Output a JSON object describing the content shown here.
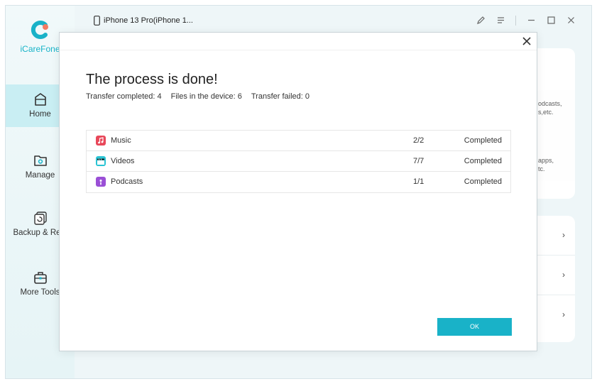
{
  "app": {
    "name": "iCareFone"
  },
  "header": {
    "device_label": "iPhone 13 Pro(iPhone 1..."
  },
  "sidebar": {
    "items": [
      {
        "label": "Home",
        "active": true,
        "icon": "home-icon"
      },
      {
        "label": "Manage",
        "active": false,
        "icon": "folder-gear-icon"
      },
      {
        "label": "Backup & Rest",
        "active": false,
        "icon": "backup-icon"
      },
      {
        "label": "More Tools",
        "active": false,
        "icon": "toolbox-icon"
      }
    ]
  },
  "background": {
    "card_text_1a": "odcasts,",
    "card_text_1b": "s,etc.",
    "card_text_2a": "apps,",
    "card_text_2b": "tc."
  },
  "dialog": {
    "title": "The process is done!",
    "stats": [
      "Transfer completed: 4",
      "Files in the device: 6",
      "Transfer failed: 0"
    ],
    "rows": [
      {
        "name": "Music",
        "count": "2/2",
        "status": "Completed",
        "icon": "music-icon",
        "color": "#e8485a"
      },
      {
        "name": "Videos",
        "count": "7/7",
        "status": "Completed",
        "icon": "clapperboard-icon",
        "color": "#29c4d4"
      },
      {
        "name": "Podcasts",
        "count": "1/1",
        "status": "Completed",
        "icon": "podcast-icon",
        "color": "#9a4fd6"
      }
    ],
    "ok_label": "OK"
  },
  "colors": {
    "accent": "#19b2c8",
    "active_nav": "#c9eef3",
    "brand_text": "#17b3c8"
  }
}
